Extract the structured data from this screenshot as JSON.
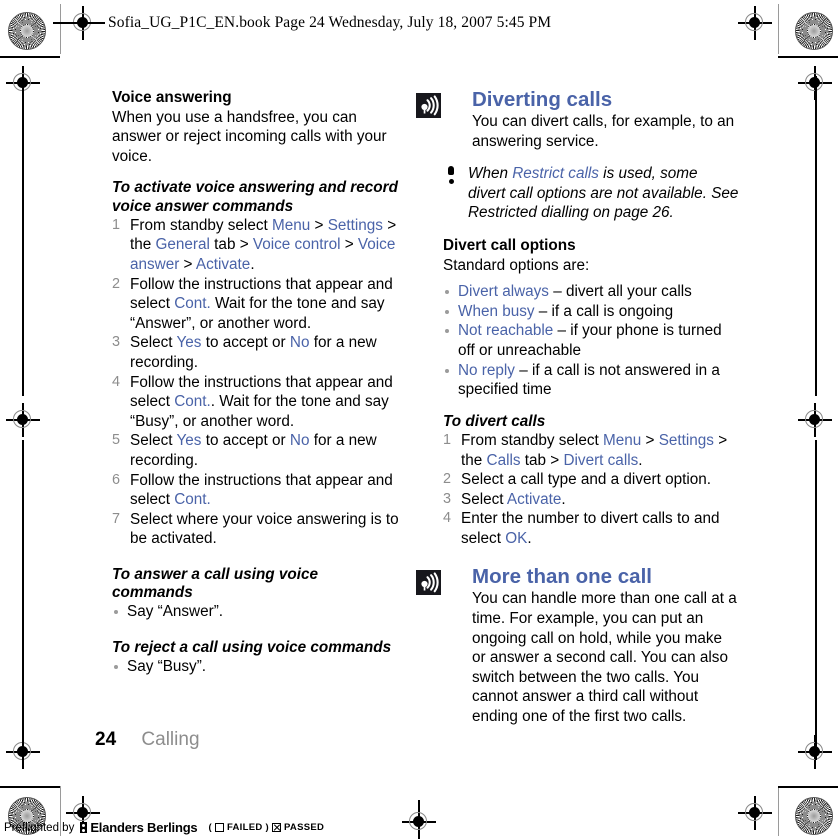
{
  "book_header": "Sofia_UG_P1C_EN.book  Page 24  Wednesday, July 18, 2007  5:45 PM",
  "left_column": {
    "heading": "Voice answering",
    "intro": "When you use a handsfree, you can answer or reject incoming calls with your voice.",
    "task1_title": "To activate voice answering and record voice answer commands",
    "task1_steps": [
      {
        "parts": [
          {
            "t": "From standby select ",
            "ui": false
          },
          {
            "t": "Menu",
            "ui": true
          },
          {
            "t": " > ",
            "ui": false
          },
          {
            "t": "Settings",
            "ui": true
          },
          {
            "t": " > the ",
            "ui": false
          },
          {
            "t": "General",
            "ui": true
          },
          {
            "t": " tab > ",
            "ui": false
          },
          {
            "t": "Voice control",
            "ui": true
          },
          {
            "t": " > ",
            "ui": false
          },
          {
            "t": "Voice answer",
            "ui": true
          },
          {
            "t": " > ",
            "ui": false
          },
          {
            "t": "Activate",
            "ui": true
          },
          {
            "t": ".",
            "ui": false
          }
        ]
      },
      {
        "parts": [
          {
            "t": "Follow the instructions that appear and select ",
            "ui": false
          },
          {
            "t": "Cont.",
            "ui": true
          },
          {
            "t": " Wait for the tone and say “Answer”, or another word.",
            "ui": false
          }
        ]
      },
      {
        "parts": [
          {
            "t": "Select ",
            "ui": false
          },
          {
            "t": "Yes",
            "ui": true
          },
          {
            "t": " to accept or ",
            "ui": false
          },
          {
            "t": "No",
            "ui": true
          },
          {
            "t": " for a new recording.",
            "ui": false
          }
        ]
      },
      {
        "parts": [
          {
            "t": "Follow the instructions that appear and select ",
            "ui": false
          },
          {
            "t": "Cont.",
            "ui": true
          },
          {
            "t": ". Wait for the tone and say “Busy”, or another word.",
            "ui": false
          }
        ]
      },
      {
        "parts": [
          {
            "t": "Select ",
            "ui": false
          },
          {
            "t": "Yes",
            "ui": true
          },
          {
            "t": " to accept or ",
            "ui": false
          },
          {
            "t": "No",
            "ui": true
          },
          {
            "t": " for a new recording.",
            "ui": false
          }
        ]
      },
      {
        "parts": [
          {
            "t": "Follow the instructions that appear and select ",
            "ui": false
          },
          {
            "t": "Cont.",
            "ui": true
          }
        ]
      },
      {
        "parts": [
          {
            "t": "Select where your voice answering is to be activated.",
            "ui": false
          }
        ]
      }
    ],
    "task2_title": "To answer a call using voice commands",
    "task2_bullets": [
      {
        "parts": [
          {
            "t": "Say “Answer”.",
            "ui": false
          }
        ]
      }
    ],
    "task3_title": "To reject a call using voice commands",
    "task3_bullets": [
      {
        "parts": [
          {
            "t": "Say “Busy”.",
            "ui": false
          }
        ]
      }
    ]
  },
  "right_column": {
    "section1": {
      "icon": "call-waves-icon",
      "heading": "Diverting calls",
      "intro": "You can divert calls, for example, to an answering service.",
      "note": {
        "icon": "exclamation-icon",
        "parts": [
          {
            "t": "When ",
            "ui": false
          },
          {
            "t": "Restrict calls",
            "ui": true
          },
          {
            "t": " is used, some divert call options are not available. See Restricted dialling on page 26.",
            "ui": false
          }
        ]
      },
      "options_heading": "Divert call options",
      "options_intro": "Standard options are:",
      "options": [
        {
          "parts": [
            {
              "t": "Divert always",
              "ui": true
            },
            {
              "t": " – divert all your calls",
              "ui": false
            }
          ]
        },
        {
          "parts": [
            {
              "t": "When busy",
              "ui": true
            },
            {
              "t": " – if a call is ongoing",
              "ui": false
            }
          ]
        },
        {
          "parts": [
            {
              "t": "Not reachable",
              "ui": true
            },
            {
              "t": " – if your phone is turned off or unreachable",
              "ui": false
            }
          ]
        },
        {
          "parts": [
            {
              "t": "No reply",
              "ui": true
            },
            {
              "t": " – if a call is not answered in a specified time",
              "ui": false
            }
          ]
        }
      ],
      "task_title": "To divert calls",
      "task_steps": [
        {
          "parts": [
            {
              "t": "From standby select ",
              "ui": false
            },
            {
              "t": "Menu",
              "ui": true
            },
            {
              "t": " > ",
              "ui": false
            },
            {
              "t": "Settings",
              "ui": true
            },
            {
              "t": " > the ",
              "ui": false
            },
            {
              "t": "Calls",
              "ui": true
            },
            {
              "t": " tab > ",
              "ui": false
            },
            {
              "t": "Divert calls",
              "ui": true
            },
            {
              "t": ".",
              "ui": false
            }
          ]
        },
        {
          "parts": [
            {
              "t": "Select a call type and a divert option.",
              "ui": false
            }
          ]
        },
        {
          "parts": [
            {
              "t": "Select ",
              "ui": false
            },
            {
              "t": "Activate",
              "ui": true
            },
            {
              "t": ".",
              "ui": false
            }
          ]
        },
        {
          "parts": [
            {
              "t": "Enter the number to divert calls to and select ",
              "ui": false
            },
            {
              "t": "OK",
              "ui": true
            },
            {
              "t": ".",
              "ui": false
            }
          ]
        }
      ]
    },
    "section2": {
      "icon": "call-waves-icon",
      "heading": "More than one call",
      "intro": "You can handle more than one call at a time. For example, you can put an ongoing call on hold, while you make or answer a second call. You can also switch between the two calls. You cannot answer a third call without ending one of the first two calls."
    }
  },
  "footer": {
    "page_number": "24",
    "section_name": "Calling"
  },
  "preflight": {
    "prefix": "Preflighted by",
    "logo_icon": "elanders-logo-icon",
    "brand": "Elanders Berlings",
    "open_paren": "(",
    "failed_label": "FAILED",
    "close_paren": ")",
    "passed_label": "PASSED",
    "failed_checked": false,
    "passed_checked": true
  },
  "colors": {
    "ui_link": "#4a63a8",
    "heading": "#4a63a8",
    "muted": "#8d8d8d",
    "icon_bg": "#17171c"
  }
}
